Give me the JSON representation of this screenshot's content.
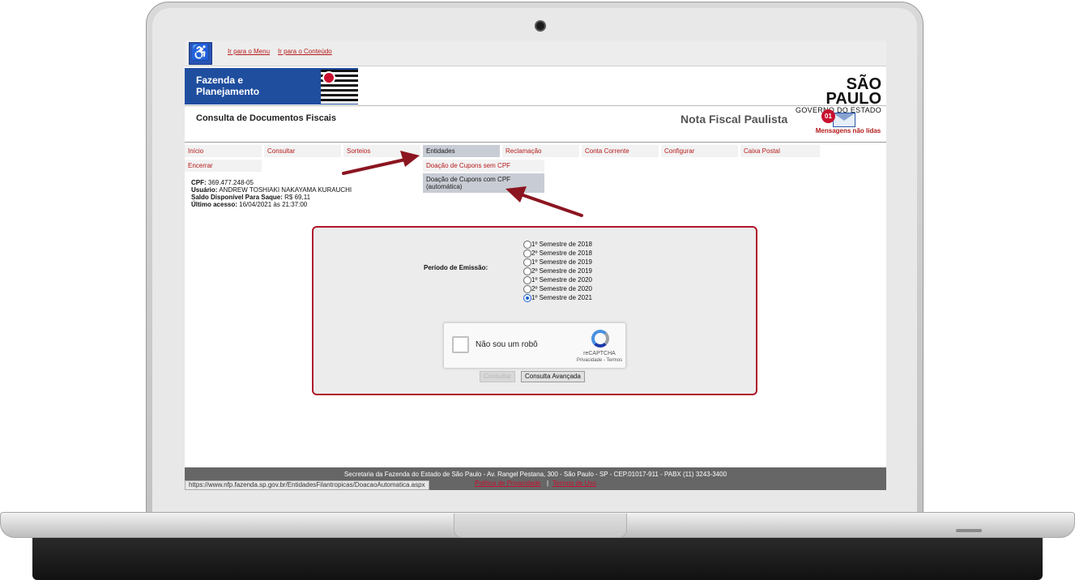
{
  "accessibility": {
    "icon": "wheelchair-icon",
    "skip_menu": "Ir para o Menu",
    "skip_content": "Ir para o Conteúdo"
  },
  "brand": {
    "fazenda": "Fazenda e Planejamento",
    "sp_title": "SÃO PAULO",
    "sp_subtitle": "GOVERNO DO ESTADO"
  },
  "header": {
    "page_title": "Consulta de Documentos Fiscais",
    "app_title": "Nota Fiscal Paulista",
    "messages_count": "01",
    "messages_label": "Mensagens não lidas"
  },
  "menu": {
    "items": [
      "Início",
      "Consultar",
      "Sorteios",
      "Entidades",
      "Reclamação",
      "Conta Corrente",
      "Configurar",
      "Caixa Postal"
    ],
    "encerrar": "Encerrar",
    "active": "Entidades",
    "submenu": [
      "Doação de Cupons sem CPF",
      "Doação de Cupons com CPF (automática)"
    ]
  },
  "user": {
    "cpf_label": "CPF:",
    "cpf": "369.477.248-05",
    "usuario_label": "Usuário:",
    "usuario": "ANDREW TOSHIAKI NAKAYAMA KURAUCHI",
    "saldo_label": "Saldo Disponível Para Saque:",
    "saldo": "R$ 69,11",
    "acesso_label": "Último acesso:",
    "acesso": "16/04/2021 às 21:37:00"
  },
  "form": {
    "periodo_label": "Período de Emissão:",
    "options": [
      "1º Semestre de 2018",
      "2º Semestre de 2018",
      "1º Semestre de 2019",
      "2º Semestre de 2019",
      "1º Semestre de 2020",
      "2º Semestre de 2020",
      "1º Semestre de 2021"
    ],
    "selected": "1º Semestre de 2021",
    "captcha_label": "Não sou um robô",
    "captcha_brand": "reCAPTCHA",
    "captcha_links": "Privacidade - Termos",
    "consultar_button": "Consultar",
    "consulta_avancada_button": "Consulta Avançada"
  },
  "footer": {
    "address": "Secretaria da Fazenda do Estado de São Paulo - Av. Rangel Pestana, 300 - São Paulo - SP - CEP.01017-911 - PABX (11) 3243-3400",
    "status_url": "https://www.nfp.fazenda.sp.gov.br/EntidadesFilantropicas/DoacaoAutomatica.aspx",
    "privacy_link": "Política de Privacidade",
    "separator": "|",
    "terms_link": "Termos de Uso"
  },
  "colors": {
    "link_red": "#b51a1a",
    "annotation_arrow": "#8b1520",
    "fazenda_blue": "#1f4e9f",
    "form_border": "#b0182a"
  }
}
